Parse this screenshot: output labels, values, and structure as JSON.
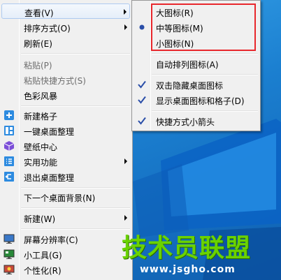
{
  "context_menu": {
    "items": [
      {
        "label": "查看(V)"
      },
      {
        "label": "排序方式(O)"
      },
      {
        "label": "刷新(E)"
      },
      {
        "label": "粘贴(P)"
      },
      {
        "label": "粘贴快捷方式(S)"
      },
      {
        "label": "色彩风暴"
      },
      {
        "label": "新建格子"
      },
      {
        "label": "一键桌面整理"
      },
      {
        "label": "壁纸中心"
      },
      {
        "label": "实用功能"
      },
      {
        "label": "退出桌面整理"
      },
      {
        "label": "下一个桌面背景(N)"
      },
      {
        "label": "新建(W)"
      },
      {
        "label": "屏幕分辨率(C)"
      },
      {
        "label": "小工具(G)"
      },
      {
        "label": "个性化(R)"
      }
    ]
  },
  "view_submenu": {
    "items": [
      {
        "label": "大图标(R)"
      },
      {
        "label": "中等图标(M)"
      },
      {
        "label": "小图标(N)"
      },
      {
        "label": "自动排列图标(A)"
      },
      {
        "label": "双击隐藏桌面图标"
      },
      {
        "label": "显示桌面图标和格子(D)"
      },
      {
        "label": "快捷方式小箭头"
      }
    ]
  },
  "watermark": {
    "title": "技术员联盟",
    "url": "www.jsgho.com"
  },
  "colors": {
    "highlight_box": "#e8272c",
    "watermark_green": "#6ad200",
    "desktop_blue": "#1b7fd0"
  }
}
